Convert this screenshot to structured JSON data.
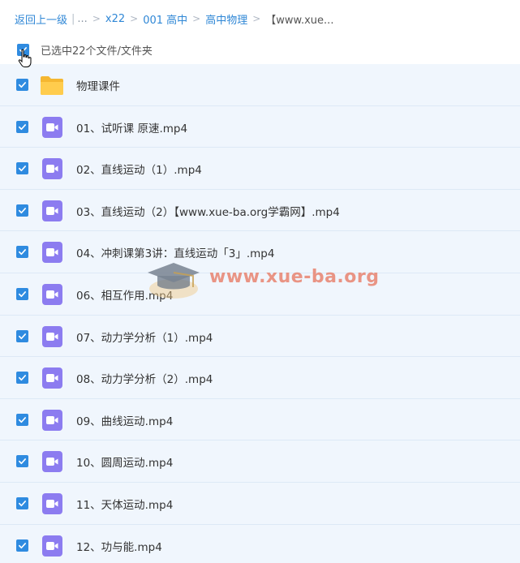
{
  "breadcrumb": {
    "back": "返回上一级",
    "ellipsis": "...",
    "items": [
      "x22",
      "001 高中",
      "高中物理"
    ],
    "current": "【www.xue..."
  },
  "selection": {
    "summary": "已选中22个文件/文件夹"
  },
  "files": [
    {
      "name": "物理课件",
      "type": "folder"
    },
    {
      "name": "01、试听课 原速.mp4",
      "type": "video"
    },
    {
      "name": "02、直线运动（1）.mp4",
      "type": "video"
    },
    {
      "name": "03、直线运动（2）【www.xue-ba.org学霸网】.mp4",
      "type": "video"
    },
    {
      "name": "04、冲刺课第3讲：直线运动「3」.mp4",
      "type": "video"
    },
    {
      "name": "06、相互作用.mp4",
      "type": "video"
    },
    {
      "name": "07、动力学分析（1）.mp4",
      "type": "video"
    },
    {
      "name": "08、动力学分析（2）.mp4",
      "type": "video"
    },
    {
      "name": "09、曲线运动.mp4",
      "type": "video"
    },
    {
      "name": "10、圆周运动.mp4",
      "type": "video"
    },
    {
      "name": "11、天体运动.mp4",
      "type": "video"
    },
    {
      "name": "12、功与能.mp4",
      "type": "video"
    }
  ],
  "watermark": {
    "text": "www.xue-ba.org"
  },
  "colors": {
    "link": "#2f87d6",
    "checkbox": "#2f8be0",
    "video_icon": "#8c7cf0",
    "folder_icon": "#ffcc4d",
    "row_bg": "#f0f6fd"
  }
}
